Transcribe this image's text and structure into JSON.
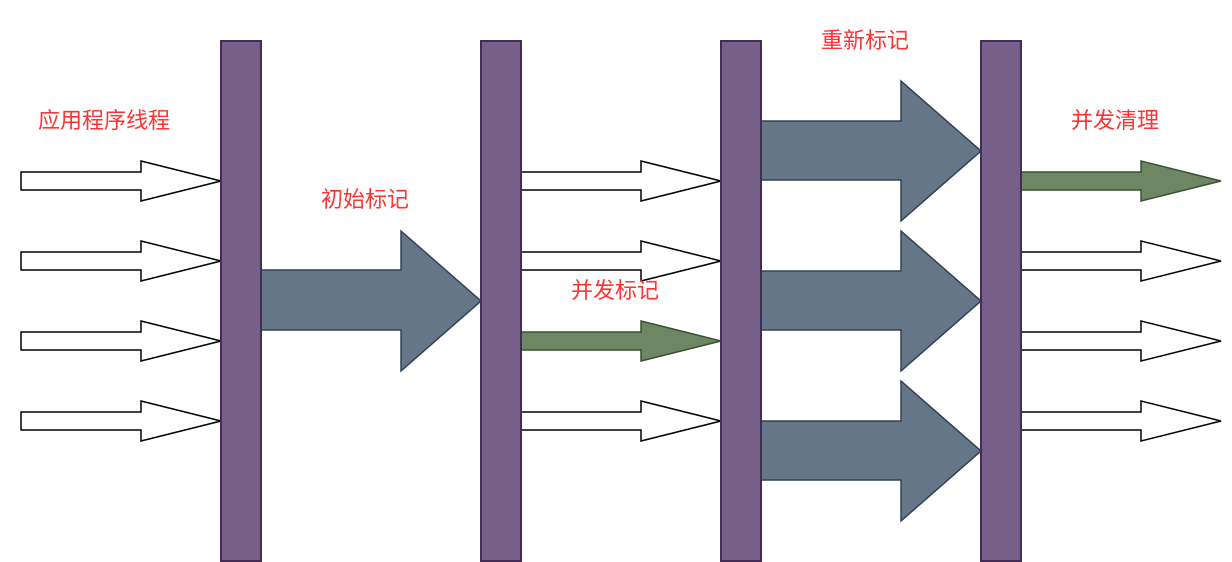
{
  "colors": {
    "barFill": "#76608a",
    "barStroke": "#432d57",
    "bigArrowFill": "#647687",
    "bigArrowStroke": "#314354",
    "greenArrowFill": "#6d8764",
    "greenArrowStroke": "#3a5431",
    "whiteArrowFill": "#ffffff",
    "whiteArrowStroke": "#000000",
    "label": "#ff3333"
  },
  "labels": {
    "app_threads": "应用程序线程",
    "initial_mark": "初始标记",
    "concurrent_mark": "并发标记",
    "remark": "重新标记",
    "concurrent_sweep": "并发清理"
  },
  "diagram": {
    "phases": [
      {
        "name": "app-threads",
        "white_threads": 4,
        "green_threads": 0
      },
      {
        "name": "initial-mark",
        "white_threads": 0,
        "green_threads": 0
      },
      {
        "name": "concurrent-mark",
        "white_threads": 3,
        "green_threads": 1
      },
      {
        "name": "remark",
        "white_threads": 0,
        "green_threads": 0
      },
      {
        "name": "concurrent-sweep",
        "white_threads": 3,
        "green_threads": 1
      }
    ]
  }
}
